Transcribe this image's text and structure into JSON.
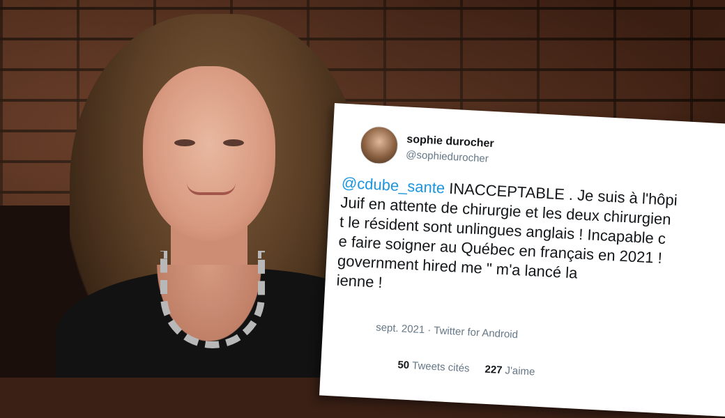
{
  "tweet": {
    "display_name": "sophie durocher",
    "handle": "@sophiedurocher",
    "mention": "@cdube_sante",
    "text": " INACCEPTABLE . Je suis à l'hôpi\nJuif en attente de chirurgie et les deux chirurgien\nt le résident sont unlingues anglais ! Incapable c\ne faire soigner au Québec en français en 2021 !\n  government hired me \" m'a lancé la\n   ienne !",
    "meta": "sept. 2021 · Twitter for Android",
    "quote_count": "50",
    "quote_label": "Tweets cités",
    "like_count": "227",
    "like_label": "J'aime"
  }
}
